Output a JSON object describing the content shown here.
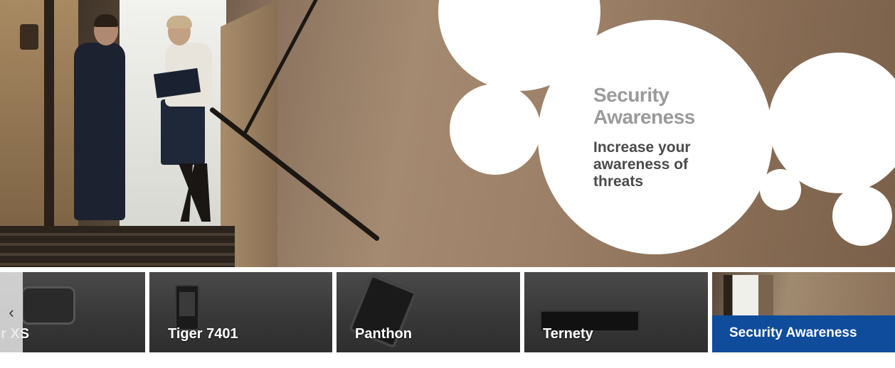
{
  "hero": {
    "title_line1": "Security",
    "title_line2": "Awareness",
    "subtitle_line1": "Increase your",
    "subtitle_line2": "awareness of",
    "subtitle_line3": "threats"
  },
  "carousel": {
    "prev_icon": "chevron-left-icon",
    "prev_glyph": "‹",
    "items": [
      {
        "label": "er XS",
        "icon": "scanner-device",
        "active": false
      },
      {
        "label": "Tiger 7401",
        "icon": "phone-device",
        "active": false
      },
      {
        "label": "Panthon",
        "icon": "tablet-device",
        "active": false
      },
      {
        "label": "Ternety",
        "icon": "rack-device",
        "active": false
      },
      {
        "label": "Security Awareness",
        "icon": "photo-thumbnail",
        "active": true
      }
    ]
  },
  "colors": {
    "active_bar": "#0f4c9c",
    "title_gray": "#9a9a9a",
    "subtitle_gray": "#4a4a4a"
  }
}
